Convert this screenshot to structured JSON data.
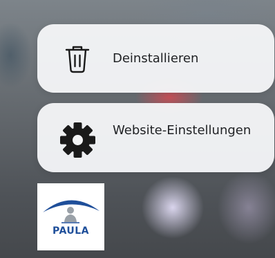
{
  "context_menu": {
    "items": [
      {
        "label": "Deinstallieren",
        "icon": "trash-icon"
      },
      {
        "label": "Website-Einstellungen",
        "icon": "gear-icon"
      }
    ]
  },
  "app": {
    "name": "PAULA",
    "logo_colors": {
      "arch_blue": "#1f4f9a",
      "figure_gray": "#9aa1a8"
    }
  },
  "colors": {
    "menu_background": "#f4f5f7",
    "menu_text": "#1f2124",
    "icon": "#1a1a1a"
  }
}
